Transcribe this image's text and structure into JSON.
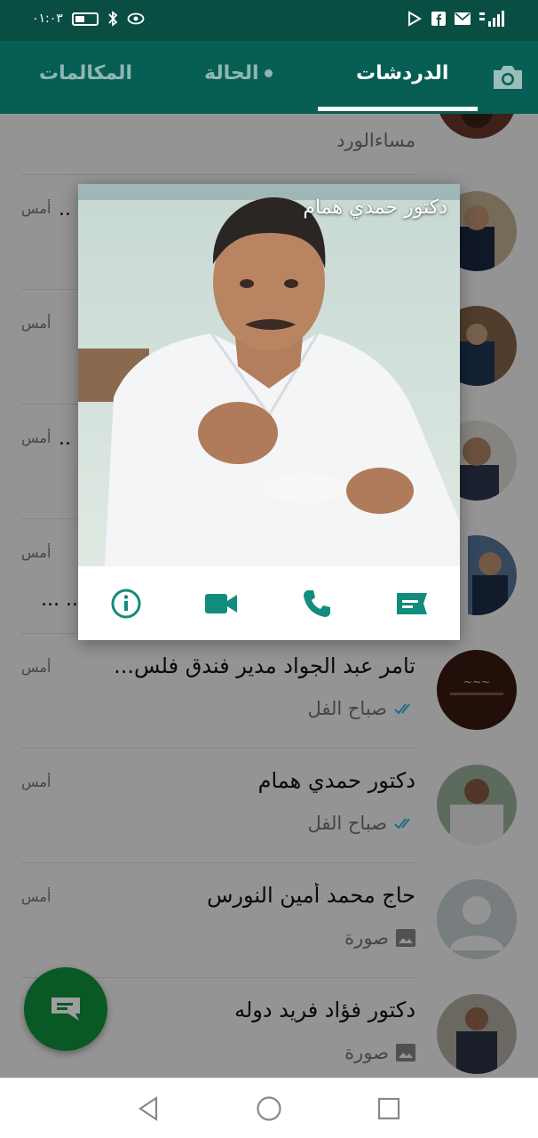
{
  "status_bar": {
    "time": "٠١:٠٣"
  },
  "tabs": {
    "chats": "الدردشات",
    "status": "الحالة",
    "calls": "المكالمات"
  },
  "chats": [
    {
      "name": "",
      "preview": "مساءالورد",
      "time": "",
      "ticks": false,
      "icon": "none"
    },
    {
      "name": "",
      "preview": "",
      "time": "أمس",
      "ticks": false,
      "icon": "none"
    },
    {
      "name": "",
      "preview": "",
      "time": "أمس",
      "ticks": false,
      "icon": "none"
    },
    {
      "name": "",
      "preview": "",
      "time": "أمس",
      "ticks": false,
      "icon": "none"
    },
    {
      "name": "",
      "preview": "",
      "time": "أمس",
      "ticks": false,
      "icon": "none"
    },
    {
      "name": "تامر عبد الجواد مدير فندق فلس...",
      "preview": "صباح الفل",
      "time": "أمس",
      "ticks": true,
      "icon": "double-check-icon"
    },
    {
      "name": "دكتور حمدي همام",
      "preview": "صباح الفل",
      "time": "أمس",
      "ticks": true,
      "icon": "double-check-icon"
    },
    {
      "name": "حاج محمد أمين النورس",
      "preview": "صورة",
      "time": "أمس",
      "ticks": false,
      "icon": "photo-icon"
    },
    {
      "name": "دكتور فؤاد فريد دوله",
      "preview": "صورة",
      "time": "",
      "ticks": false,
      "icon": "photo-icon"
    }
  ],
  "popup": {
    "name": "دكتور حمدي همام",
    "actions": [
      "message-icon",
      "call-icon",
      "video-call-icon",
      "info-icon"
    ]
  },
  "colors": {
    "header": "#075e54",
    "status_bar": "#0a4e43",
    "accent": "#128c7e",
    "fab": "#0f8f3c",
    "tick": "#34b7f1"
  }
}
